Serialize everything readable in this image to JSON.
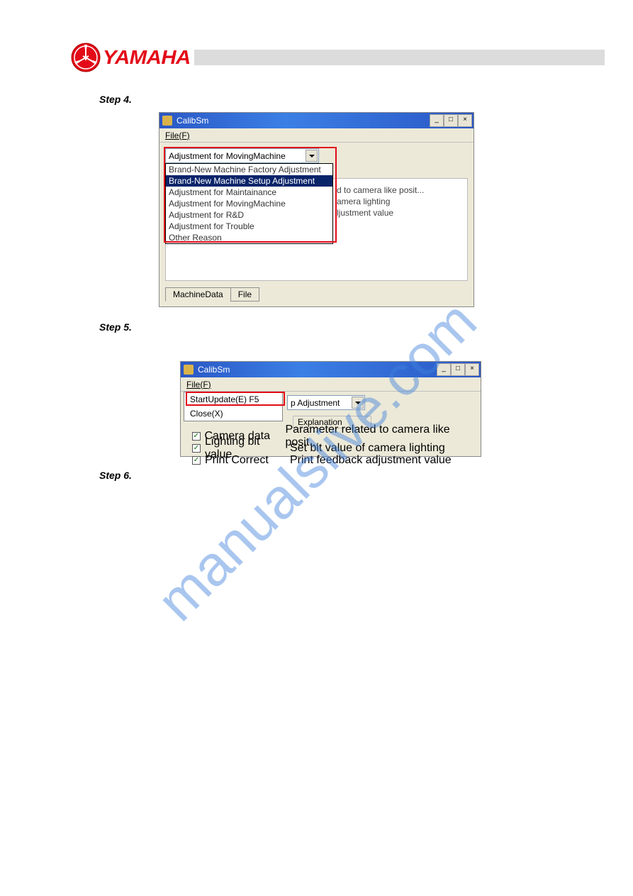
{
  "brand": {
    "name": "YAMAHA"
  },
  "watermark": "manualslive.com",
  "steps": {
    "s4": {
      "label": "Step 4."
    },
    "s5": {
      "label": "Step 5."
    },
    "s6": {
      "label": "Step 6."
    }
  },
  "window4": {
    "title": "CalibSm",
    "menu_file": "File(F)",
    "combo_selected": "Adjustment for MovingMachine",
    "options": [
      "Brand-New Machine Factory Adjustment",
      "Brand-New Machine Setup Adjustment",
      "Adjustment for Maintainance",
      "Adjustment for MovingMachine",
      "Adjustment for R&D",
      "Adjustment for Trouble",
      "Other Reason"
    ],
    "highlighted_index": 1,
    "partial_explanations": [
      "d to camera like posit...",
      "amera lighting",
      "ljustment value"
    ],
    "tabs": {
      "a": "MachineData",
      "b": "File"
    },
    "win_buttons": {
      "min": "_",
      "max": "□",
      "close": "×"
    }
  },
  "window5": {
    "title": "CalibSm",
    "menu_file": "File(F)",
    "menu_items": {
      "start": "StartUpdate(E)   F5",
      "close": "Close(X)"
    },
    "combo_partial": "p Adjustment",
    "col_explanation": "Explanation",
    "rows": [
      {
        "checked": true,
        "name": "Camera data",
        "exp": "Parameter related to camera like posit..."
      },
      {
        "checked": true,
        "name": "Lighting bit value",
        "exp": "Set bit value of camera lighting"
      },
      {
        "checked": true,
        "name": "Print Correct",
        "exp": "Print feedback adjustment value"
      }
    ],
    "win_buttons": {
      "min": "_",
      "max": "□",
      "close": "×"
    }
  }
}
